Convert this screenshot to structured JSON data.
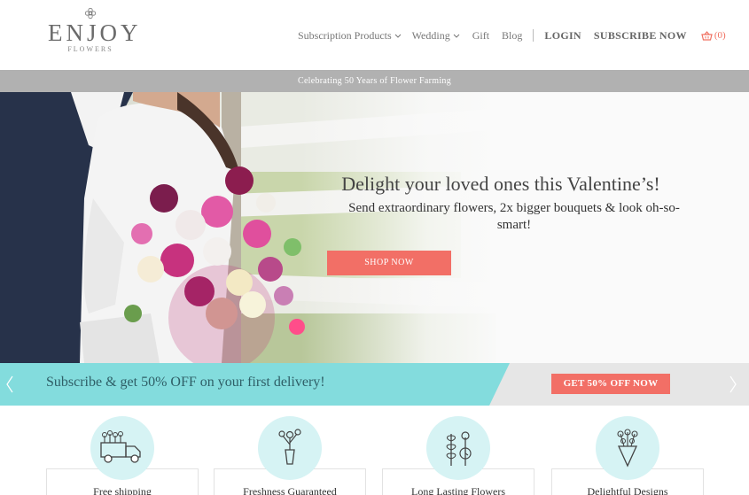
{
  "brand": {
    "name": "ENJOY",
    "tagline": "FLOWERS"
  },
  "nav": {
    "items": [
      {
        "label": "Subscription Products",
        "has_dropdown": true
      },
      {
        "label": "Wedding",
        "has_dropdown": true
      },
      {
        "label": "Gift",
        "has_dropdown": false
      },
      {
        "label": "Blog",
        "has_dropdown": false
      }
    ],
    "login": "LOGIN",
    "subscribe": "SUBSCRIBE NOW",
    "cart_count": "(0)",
    "cart_icon": "shopping-basket-icon"
  },
  "announcement": "Celebrating 50 Years of Flower Farming",
  "hero": {
    "title": "Delight your loved ones this Valentine’s!",
    "subtitle": "Send extraordinary flowers, 2x bigger bouquets & look oh-so-smart!",
    "button": "SHOP NOW"
  },
  "promo": {
    "text": "Subscribe & get 50% OFF on your first delivery!",
    "button": "GET 50% OFF NOW",
    "prev_icon": "chevron-left-icon",
    "next_icon": "chevron-right-icon"
  },
  "features": [
    {
      "label": "Free shipping",
      "icon": "flower-truck-icon"
    },
    {
      "label": "Freshness Guaranteed",
      "icon": "flower-vase-icon"
    },
    {
      "label": "Long Lasting Flowers",
      "icon": "flower-stems-icon"
    },
    {
      "label": "Delightful Designs",
      "icon": "bouquet-icon"
    }
  ],
  "colors": {
    "accent": "#f26f66",
    "teal": "#83dcdd",
    "light_teal": "#d6f3f4",
    "announcement_bg": "#b1b1b1"
  }
}
